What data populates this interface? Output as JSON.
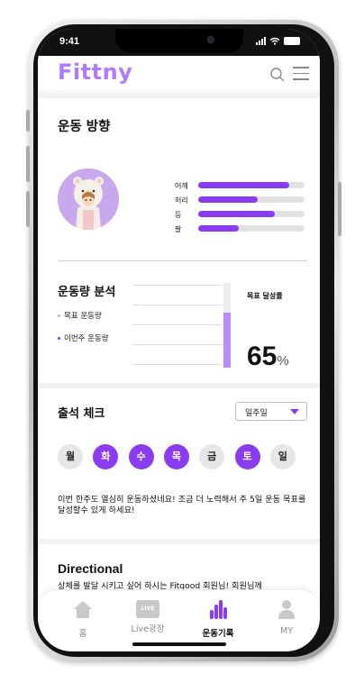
{
  "status": {
    "time": "9:41"
  },
  "header": {
    "logo": "Fittny"
  },
  "direction": {
    "title": "운동 방향",
    "bars": [
      {
        "label": "어깨",
        "value": 0.86
      },
      {
        "label": "허리",
        "value": 0.56
      },
      {
        "label": "등",
        "value": 0.72
      },
      {
        "label": "팔",
        "value": 0.38
      }
    ]
  },
  "analysis": {
    "title": "운동량 분석",
    "legend_target": "목표 운동량",
    "legend_this_week": "이번주 운동량",
    "goal_label": "목표 달성률",
    "goal_value": "65",
    "goal_unit": "%",
    "goal_fill": 0.65
  },
  "attendance": {
    "title": "출석 체크",
    "period_selected": "일주일",
    "days": [
      {
        "label": "월",
        "attended": false
      },
      {
        "label": "화",
        "attended": true
      },
      {
        "label": "수",
        "attended": true
      },
      {
        "label": "목",
        "attended": true
      },
      {
        "label": "금",
        "attended": false
      },
      {
        "label": "토",
        "attended": true
      },
      {
        "label": "일",
        "attended": false
      }
    ],
    "message": "이번 한주도 열심히 운동하셨네요! 조금 더 노력해서 주 5일 운동 목표를 달성할수 있게 하세요!"
  },
  "directional": {
    "title": "Directional",
    "text": "상체를 발달 시키고 싶어 하시는 Fitgood 회원님! 회원님께"
  },
  "nav": {
    "home": "홈",
    "live_badge": "LIVE",
    "live": "Live광장",
    "records": "운동기록",
    "my": "MY"
  },
  "colors": {
    "accent": "#8b3cf0",
    "logo": "#b07bff",
    "inactive": "#e6e6e6"
  }
}
